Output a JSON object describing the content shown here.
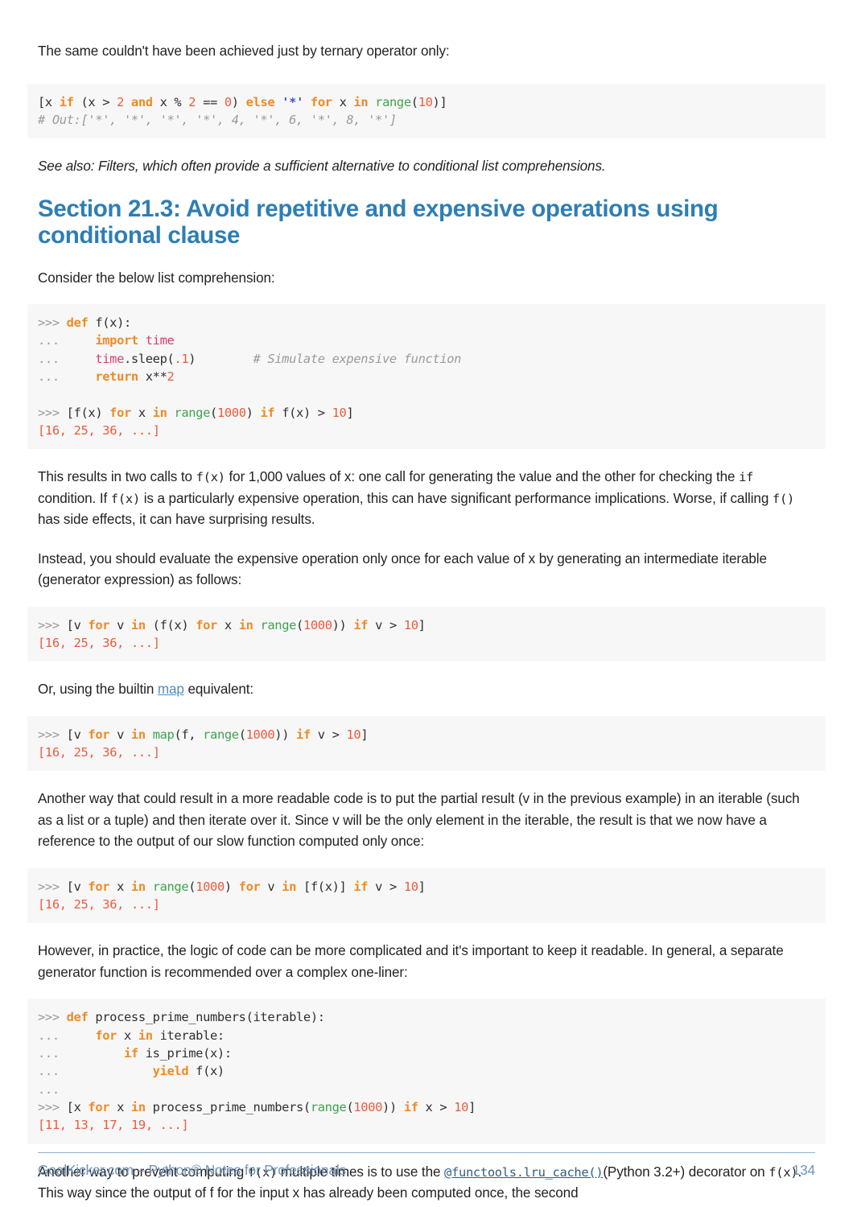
{
  "page": {
    "intro_paragraph": "The same couldn't have been achieved just by ternary operator only:",
    "see_also": "See also: Filters, which often provide a sufficient alternative to conditional list comprehensions.",
    "heading": "Section 21.3: Avoid repetitive and expensive operations using conditional clause",
    "consider": "Consider the below list comprehension:",
    "para_two_calls_1": "This results in two calls to ",
    "para_two_calls_c1": "f(x)",
    "para_two_calls_2": " for 1,000 values of x: one call for generating the value and the other for checking the ",
    "para_two_calls_c2": "if",
    "para_two_calls_3": " condition. If ",
    "para_two_calls_c3": "f(x)",
    "para_two_calls_4": " is a particularly expensive operation, this can have significant performance implications. Worse, if calling ",
    "para_two_calls_c4": "f()",
    "para_two_calls_5": " has side effects, it can have surprising results.",
    "para_instead": "Instead, you should evaluate the expensive operation only once for each value of x by generating an intermediate iterable (generator expression) as follows:",
    "para_builtin_1": "Or, using the builtin ",
    "para_builtin_link": "map",
    "para_builtin_2": " equivalent:",
    "para_readable": "Another way that could result in a more readable code is to put the partial result (v in the previous example) in an iterable (such as a list or a tuple) and then iterate over it. Since v will be the only element in the iterable, the result is that we now have a reference to the output of our slow function computed only once:",
    "para_however": "However, in practice, the logic of code can be more complicated and it's important to keep it readable. In general, a separate generator function is recommended over a complex one-liner:",
    "para_lru_1": "Another way to prevent computing ",
    "para_lru_c1": "f(x)",
    "para_lru_2": " multiple times is to use the ",
    "para_lru_link": "@functools.lru_cache()",
    "para_lru_3": "(Python 3.2+) decorator on ",
    "para_lru_c2": "f(x)",
    "para_lru_4": ". This way since the output of f for the input x has already been computed once, the second"
  },
  "code_blocks": {
    "ternary": {
      "line1_p1": "[x ",
      "line1_if": "if",
      "line1_p2": " (x > ",
      "line1_n1": "2",
      "line1_and": " and",
      "line1_p3": " x % ",
      "line1_n2": "2",
      "line1_p4": " == ",
      "line1_n3": "0",
      "line1_p5": ") ",
      "line1_else": "else",
      "line1_p6": " ",
      "line1_str": "'*'",
      "line1_for": " for",
      "line1_p7": " x ",
      "line1_in": "in",
      "line1_p8": " ",
      "line1_range": "range",
      "line1_p9": "(",
      "line1_n4": "10",
      "line1_p10": ")]",
      "line2_comment": "# Out:['*', '*', '*', '*', 4, '*', 6, '*', 8, '*']"
    },
    "def_f": {
      "l1_pr": ">>> ",
      "l1_kw": "def",
      "l1_rest": " f(x):",
      "l2_pr": "... ",
      "l2_kw": "    import",
      "l2_mod": " time",
      "l3_pr": "... ",
      "l3_mod": "    time",
      "l3_rest": ".sleep(",
      "l3_num": ".1",
      "l3_rest2": ")",
      "l3_comment": "        # Simulate expensive function",
      "l4_pr": "... ",
      "l4_kw": "    return",
      "l4_rest": " x**",
      "l4_num": "2",
      "l5_blank": "",
      "l6_pr": ">>> ",
      "l6_p1": "[f(x) ",
      "l6_for": "for",
      "l6_p2": " x ",
      "l6_in": "in",
      "l6_p3": " ",
      "l6_range": "range",
      "l6_p4": "(",
      "l6_n1": "1000",
      "l6_p5": ") ",
      "l6_if": "if",
      "l6_p6": " f(x) > ",
      "l6_n2": "10",
      "l6_p7": "]",
      "l7_out_p1": "[",
      "l7_out_n1": "16",
      "l7_out_p2": ", ",
      "l7_out_n2": "25",
      "l7_out_p3": ", ",
      "l7_out_n3": "36",
      "l7_out_p4": ", ...]"
    },
    "genexp": {
      "l1_pr": ">>> ",
      "l1_p1": "[v ",
      "l1_for1": "for",
      "l1_p2": " v ",
      "l1_in1": "in",
      "l1_p3": " (f(x) ",
      "l1_for2": "for",
      "l1_p4": " x ",
      "l1_in2": "in",
      "l1_p5": " ",
      "l1_range": "range",
      "l1_p6": "(",
      "l1_n1": "1000",
      "l1_p7": ")) ",
      "l1_if": "if",
      "l1_p8": " v > ",
      "l1_n2": "10",
      "l1_p9": "]",
      "l2_out_p1": "[",
      "l2_out_n1": "16",
      "l2_out_p2": ", ",
      "l2_out_n2": "25",
      "l2_out_p3": ", ",
      "l2_out_n3": "36",
      "l2_out_p4": ", ...]"
    },
    "mapexp": {
      "l1_pr": ">>> ",
      "l1_p1": "[v ",
      "l1_for": "for",
      "l1_p2": " v ",
      "l1_in": "in",
      "l1_p3": " ",
      "l1_map": "map",
      "l1_p4": "(f, ",
      "l1_range": "range",
      "l1_p5": "(",
      "l1_n1": "1000",
      "l1_p6": ")) ",
      "l1_if": "if",
      "l1_p7": " v > ",
      "l1_n2": "10",
      "l1_p8": "]",
      "l2_out_p1": "[",
      "l2_out_n1": "16",
      "l2_out_p2": ", ",
      "l2_out_n2": "25",
      "l2_out_p3": ", ",
      "l2_out_n3": "36",
      "l2_out_p4": ", ...]"
    },
    "nested": {
      "l1_pr": ">>> ",
      "l1_p1": "[v ",
      "l1_for1": "for",
      "l1_p2": " x ",
      "l1_in1": "in",
      "l1_p3": " ",
      "l1_range": "range",
      "l1_p4": "(",
      "l1_n1": "1000",
      "l1_p5": ") ",
      "l1_for2": "for",
      "l1_p6": " v ",
      "l1_in2": "in",
      "l1_p7": " [f(x)] ",
      "l1_if": "if",
      "l1_p8": " v > ",
      "l1_n2": "10",
      "l1_p9": "]",
      "l2_out_p1": "[",
      "l2_out_n1": "16",
      "l2_out_p2": ", ",
      "l2_out_n2": "25",
      "l2_out_p3": ", ",
      "l2_out_n3": "36",
      "l2_out_p4": ", ...]"
    },
    "generator_fn": {
      "l1_pr": ">>> ",
      "l1_kw": "def",
      "l1_rest": " process_prime_numbers(iterable):",
      "l2_pr": "... ",
      "l2_kw": "    for",
      "l2_p1": " x ",
      "l2_in": "in",
      "l2_rest": " iterable:",
      "l3_pr": "... ",
      "l3_kw": "        if",
      "l3_rest": " is_prime(x):",
      "l4_pr": "... ",
      "l4_kw": "            yield",
      "l4_rest": " f(x)",
      "l5_pr": "...",
      "l6_pr": ">>> ",
      "l6_p1": "[x ",
      "l6_for": "for",
      "l6_p2": " x ",
      "l6_in": "in",
      "l6_p3": " process_prime_numbers(",
      "l6_range": "range",
      "l6_p4": "(",
      "l6_n1": "1000",
      "l6_p5": ")) ",
      "l6_if": "if",
      "l6_p6": " x > ",
      "l6_n2": "10",
      "l6_p7": "]",
      "l7_out_p1": "[",
      "l7_out_n1": "11",
      "l7_out_p2": ", ",
      "l7_out_n2": "13",
      "l7_out_p3": ", ",
      "l7_out_n3": "17",
      "l7_out_p4": ", ",
      "l7_out_n4": "19",
      "l7_out_p5": ", ...]"
    }
  },
  "footer": {
    "text": "GoalKicker.com – Python® Notes for Professionals",
    "page_number": "134"
  },
  "colors": {
    "heading": "#2e7eb5",
    "footer": "#6f96b8",
    "link": "#4f8fc0",
    "keyword": "#f08a24",
    "number": "#ef5a3b",
    "builtin": "#3fa34a",
    "module": "#d23f6a",
    "string": "#4357c4",
    "comment": "#9a9a9a",
    "code_bg": "#f7f7f8"
  }
}
